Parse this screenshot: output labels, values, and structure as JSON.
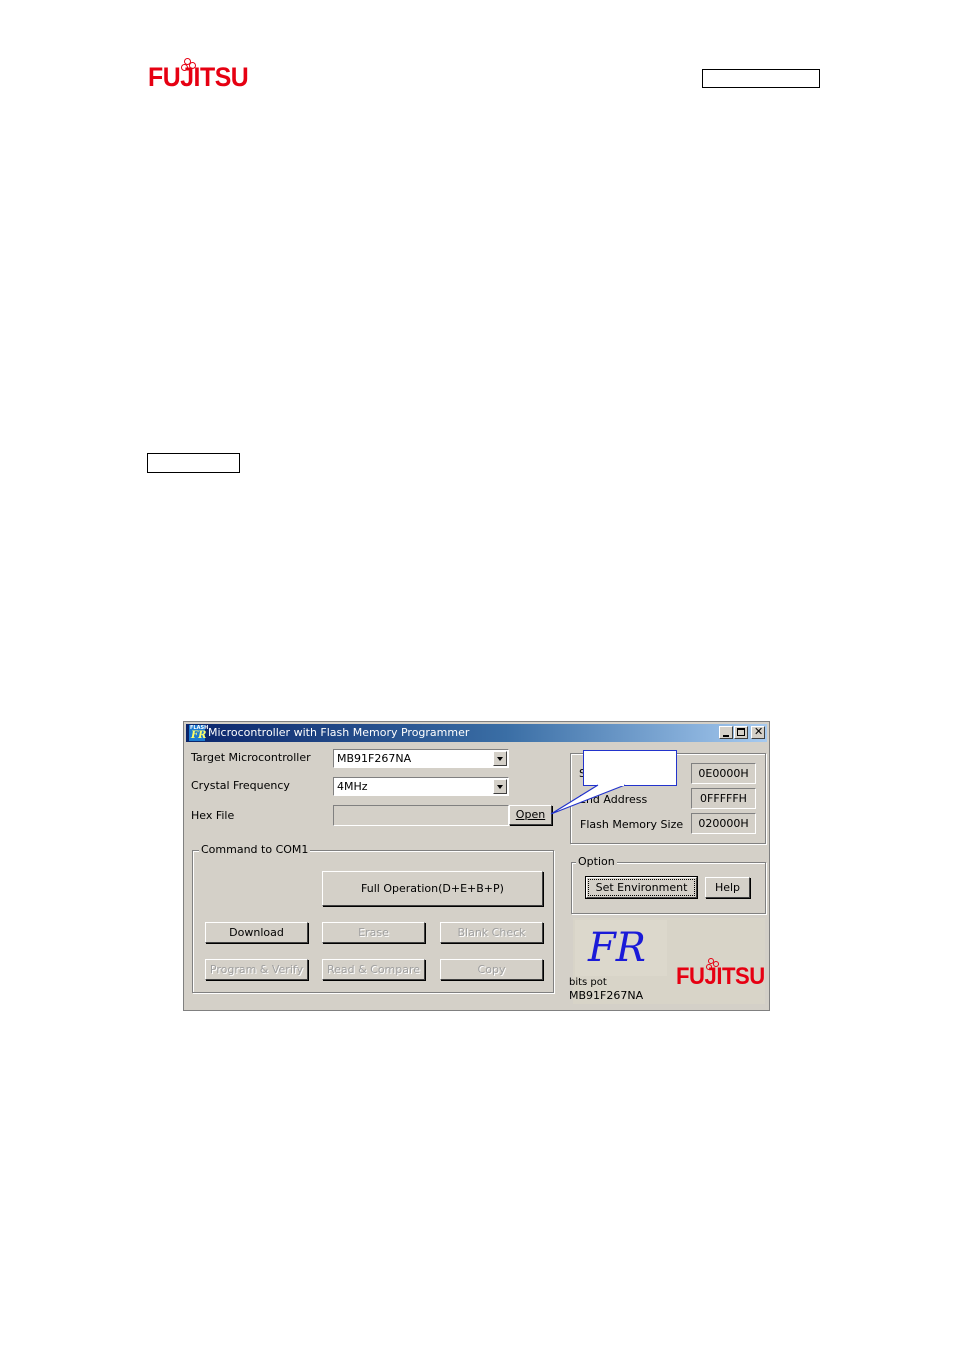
{
  "header": {
    "logo_text": "FUJITSU"
  },
  "window": {
    "icon_label_top": "FLASH",
    "icon_label_bottom": "FR",
    "title": "Microcontroller with Flash Memory Programmer",
    "target_label": "Target Microcontroller",
    "target_value": "MB91F267NA",
    "crystal_label": "Crystal Frequency",
    "crystal_value": "4MHz",
    "hexfile_label": "Hex File",
    "hexfile_value": "",
    "open_button": "Open",
    "start_label": "S",
    "start_value": "0E0000H",
    "end_label": "End Address",
    "end_value": "0FFFFFH",
    "flash_size_label": "Flash Memory Size",
    "flash_size_value": "020000H",
    "command_group": "Command to COM1",
    "full_operation": "Full Operation(D+E+B+P)",
    "download": "Download",
    "erase": "Erase",
    "blank_check": "Blank Check",
    "program_verify": "Program & Verify",
    "read_compare": "Read & Compare",
    "copy": "Copy",
    "option_group": "Option",
    "set_environment": "Set Environment",
    "help": "Help",
    "fr_logo": "FR",
    "bits_label": "bits pot",
    "device_label": "MB91F267NA",
    "window_logo": "FUJITSU"
  }
}
